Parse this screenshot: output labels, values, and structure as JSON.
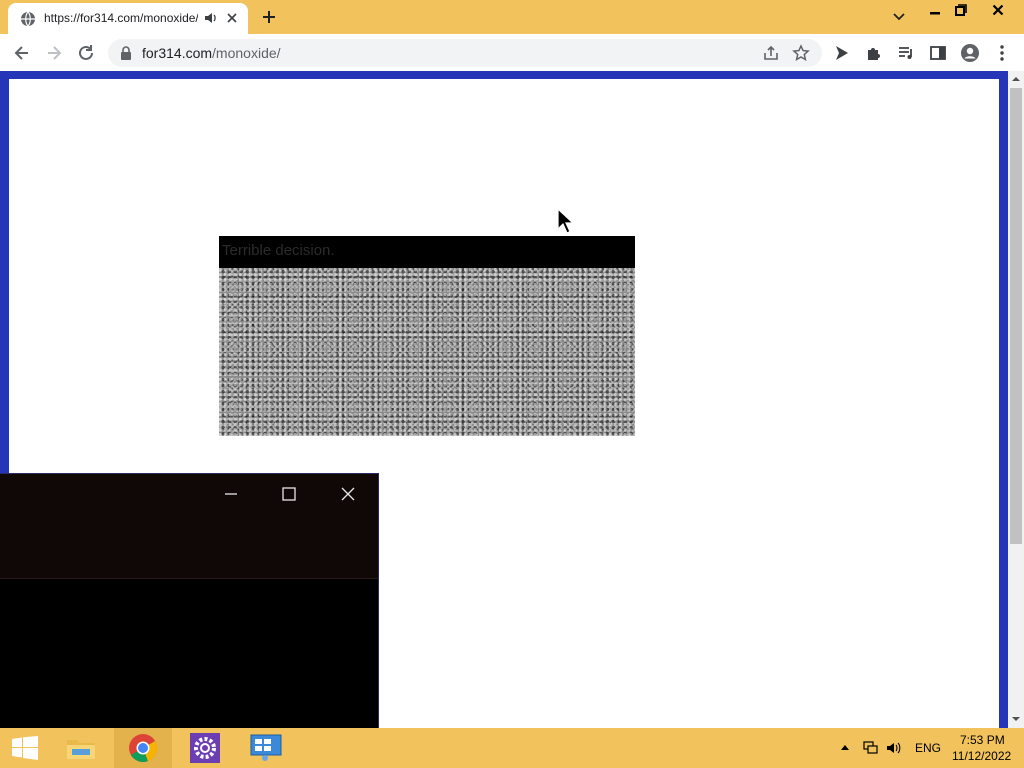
{
  "browser": {
    "tab": {
      "title": "https://for314.com/monoxide/",
      "favicon": "globe-icon",
      "audio_icon": "speaker-icon"
    },
    "toolbar": {
      "url_host": "for314.com",
      "url_path": "/monoxide/"
    },
    "colors": {
      "frame": "#f2c35c",
      "page_border": "#2535b8"
    }
  },
  "page": {
    "noise_panel": {
      "caption": "Terrible decision."
    }
  },
  "taskbar": {
    "apps": [
      "windows-start",
      "file-explorer",
      "chrome",
      "settings",
      "control-panel"
    ],
    "tray": {
      "language": "ENG",
      "time": "7:53 PM",
      "date": "11/12/2022"
    }
  }
}
